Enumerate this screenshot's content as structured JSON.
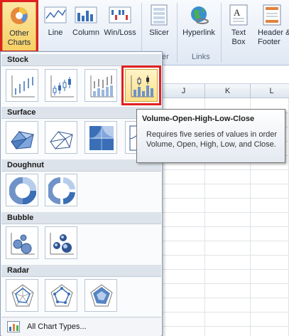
{
  "ribbon": {
    "other_charts_label": "Other Charts",
    "buttons": {
      "line": "Line",
      "column": "Column",
      "winloss": "Win/Loss",
      "slicer": "Slicer",
      "hyperlink": "Hyperlink",
      "textbox": "Text Box",
      "header_footer": "Header & Footer"
    },
    "groups": {
      "filter": "er",
      "links": "Links"
    }
  },
  "sheet": {
    "columns": [
      "J",
      "K",
      "L"
    ]
  },
  "dropdown": {
    "sections": {
      "stock": "Stock",
      "surface": "Surface",
      "doughnut": "Doughnut",
      "bubble": "Bubble",
      "radar": "Radar"
    },
    "all_chart_types": "All Chart Types..."
  },
  "tooltip": {
    "title": "Volume-Open-High-Low-Close",
    "body": "Requires five series of values in order Volume, Open, High, Low, and Close."
  },
  "colors": {
    "highlight_border": "#e0201f",
    "selected_fill": "#fde08a",
    "accent_blue": "#3a6fb7"
  }
}
